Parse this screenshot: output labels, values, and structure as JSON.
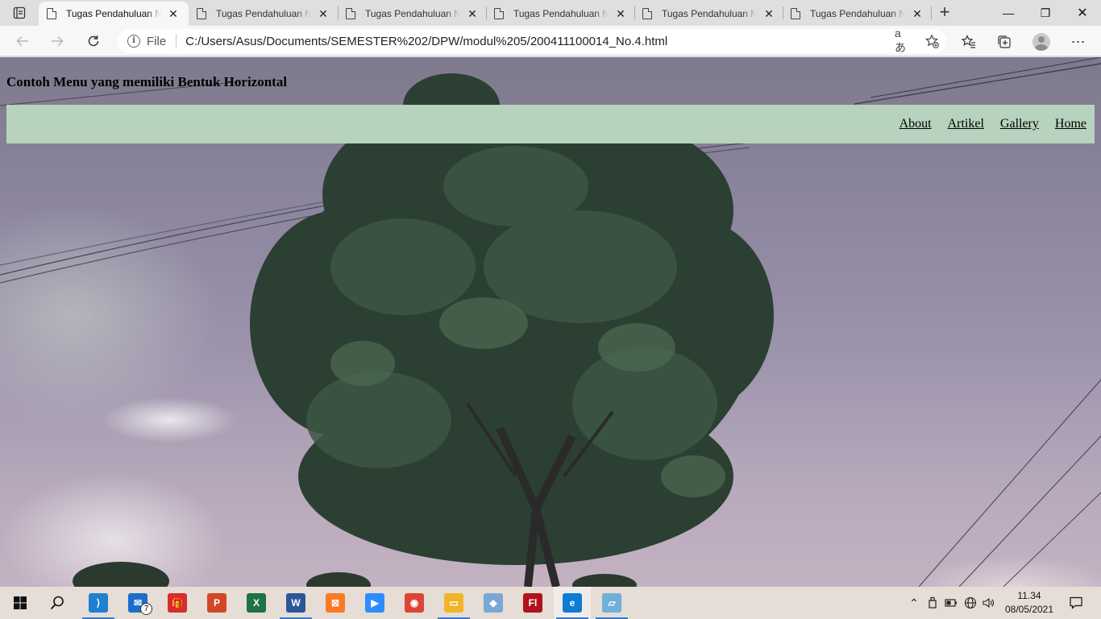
{
  "browser": {
    "tabs": [
      {
        "title": "Tugas Pendahuluan No",
        "active": true
      },
      {
        "title": "Tugas Pendahuluan No",
        "active": false
      },
      {
        "title": "Tugas Pendahuluan No",
        "active": false
      },
      {
        "title": "Tugas Pendahuluan No",
        "active": false
      },
      {
        "title": "Tugas Pendahuluan No",
        "active": false
      },
      {
        "title": "Tugas Pendahuluan No",
        "active": false
      }
    ],
    "tab_close_glyph": "✕",
    "new_tab_glyph": "+",
    "window_controls": {
      "minimize": "—",
      "maximize": "❐",
      "close": "✕"
    },
    "address": {
      "scheme_label": "File",
      "url": "C:/Users/Asus/Documents/SEMESTER%202/DPW/modul%205/200411100014_No.4.html",
      "read_aloud_glyph": "aあ"
    }
  },
  "page": {
    "heading": "Contoh Menu yang memiliki Bentuk Horizontal",
    "menu": [
      "Home",
      "Gallery",
      "Artikel",
      "About"
    ],
    "menu_bar_color": "#b7d3bd"
  },
  "taskbar": {
    "apps": [
      {
        "name": "vscode",
        "icon": "vscode-icon",
        "color": "#1f7fd0",
        "glyph": "⟩",
        "running": true
      },
      {
        "name": "mail",
        "icon": "mail-icon",
        "color": "#1a6fc9",
        "glyph": "✉",
        "badge": "7"
      },
      {
        "name": "gift",
        "icon": "gift-icon",
        "color": "#d62d2d",
        "glyph": "🎁"
      },
      {
        "name": "powerpoint",
        "icon": "powerpoint-icon",
        "color": "#d24726",
        "glyph": "P"
      },
      {
        "name": "excel",
        "icon": "excel-icon",
        "color": "#1f7244",
        "glyph": "X"
      },
      {
        "name": "word",
        "icon": "word-icon",
        "color": "#2b579a",
        "glyph": "W",
        "running": true
      },
      {
        "name": "xampp",
        "icon": "xampp-icon",
        "color": "#fb7a24",
        "glyph": "⊠"
      },
      {
        "name": "zoom",
        "icon": "zoom-icon",
        "color": "#2d8cff",
        "glyph": "▶"
      },
      {
        "name": "chrome",
        "icon": "chrome-icon",
        "color": "#db4437",
        "glyph": "◉"
      },
      {
        "name": "file-explorer",
        "icon": "folder-icon",
        "color": "#f0b429",
        "glyph": "▭",
        "running": true
      },
      {
        "name": "paint",
        "icon": "paint-icon",
        "color": "#7aa7d8",
        "glyph": "◆"
      },
      {
        "name": "flash",
        "icon": "flash-icon",
        "color": "#b2121b",
        "glyph": "Fl"
      },
      {
        "name": "edge",
        "icon": "edge-icon",
        "color": "#0c7cd5",
        "glyph": "e",
        "running": true,
        "current": true
      },
      {
        "name": "notepad",
        "icon": "notepad-icon",
        "color": "#6fb0d8",
        "glyph": "▱",
        "running": true
      }
    ],
    "clock_time": "11.34",
    "clock_date": "08/05/2021"
  }
}
